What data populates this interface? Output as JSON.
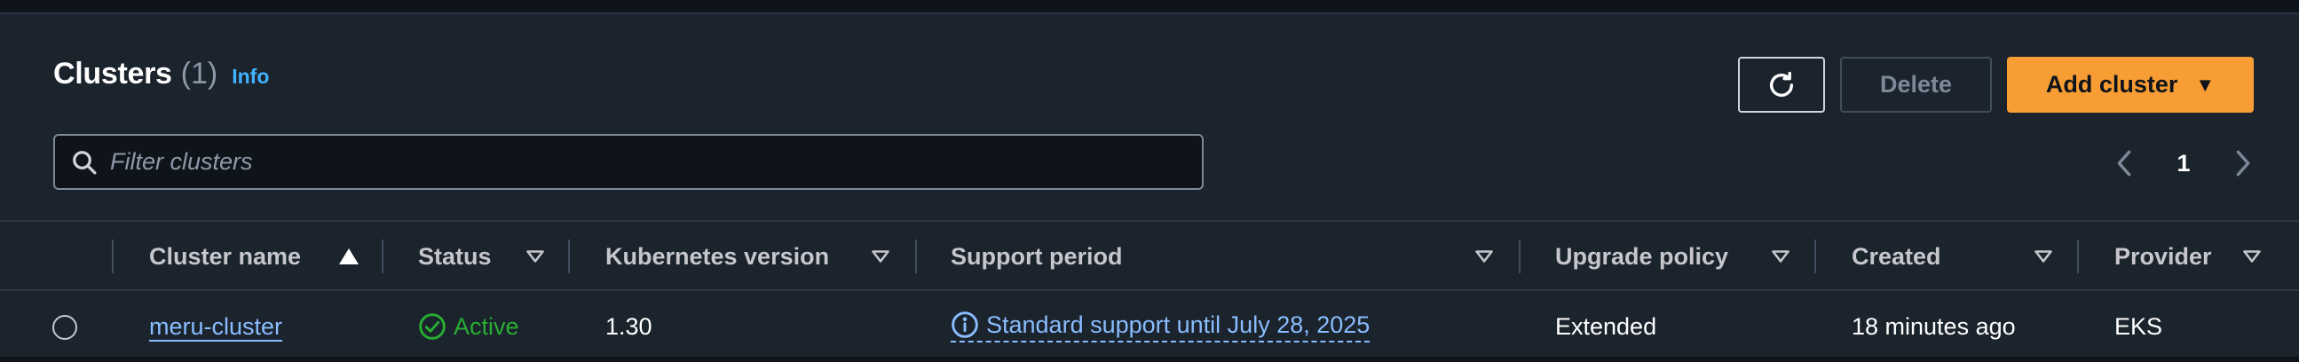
{
  "header": {
    "title": "Clusters",
    "count": "(1)",
    "info_link": "Info"
  },
  "toolbar": {
    "refresh_icon": "refresh-icon",
    "delete_label": "Delete",
    "add_label": "Add cluster",
    "add_caret_icon": "caret-down-icon"
  },
  "search": {
    "placeholder": "Filter clusters",
    "value": ""
  },
  "pagination": {
    "current_page": "1"
  },
  "table": {
    "columns": [
      {
        "label": "Cluster name",
        "sort": "ascending"
      },
      {
        "label": "Status",
        "sort": "none"
      },
      {
        "label": "Kubernetes version",
        "sort": "none"
      },
      {
        "label": "Support period",
        "sort": "none"
      },
      {
        "label": "Upgrade policy",
        "sort": "none"
      },
      {
        "label": "Created",
        "sort": "none"
      },
      {
        "label": "Provider",
        "sort": "none"
      }
    ],
    "rows": [
      {
        "name": "meru-cluster",
        "status": "Active",
        "kubernetes_version": "1.30",
        "support_period": "Standard support until July 28, 2025",
        "upgrade_policy": "Extended",
        "created": "18 minutes ago",
        "provider": "EKS"
      }
    ]
  },
  "colors": {
    "accent": "#f89c34",
    "link": "#89bdff",
    "info": "#42b4ff",
    "status_active": "#29ad32",
    "background": "#1b232d"
  }
}
